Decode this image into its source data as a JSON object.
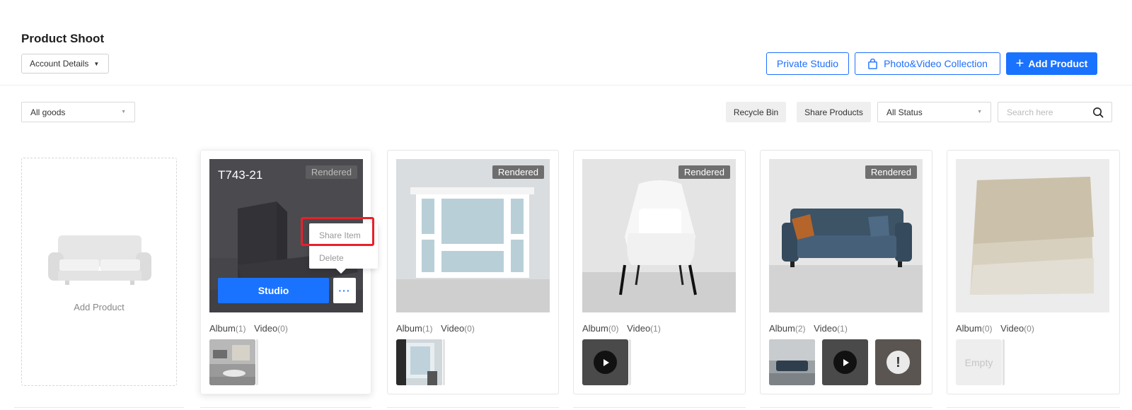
{
  "header": {
    "title": "Product Shoot",
    "account_label": "Account Details",
    "private_studio": "Private Studio",
    "collection": "Photo&Video Collection",
    "add_product": "Add Product"
  },
  "filters": {
    "goods": "All goods",
    "recycle_bin": "Recycle Bin",
    "share_products": "Share Products",
    "status": "All Status",
    "search_placeholder": "Search here"
  },
  "add_card": {
    "label": "Add Product"
  },
  "cards": [
    {
      "sku": "T743-21",
      "badge": "Rendered",
      "studio": "Studio",
      "more": "···",
      "album_label": "Album",
      "album_count": "(1)",
      "video_label": "Video",
      "video_count": "(0)"
    },
    {
      "badge": "Rendered",
      "album_label": "Album",
      "album_count": "(1)",
      "video_label": "Video",
      "video_count": "(0)"
    },
    {
      "badge": "Rendered",
      "album_label": "Album",
      "album_count": "(0)",
      "video_label": "Video",
      "video_count": "(1)"
    },
    {
      "badge": "Rendered",
      "album_label": "Album",
      "album_count": "(2)",
      "video_label": "Video",
      "video_count": "(1)"
    },
    {
      "album_label": "Album",
      "album_count": "(0)",
      "video_label": "Video",
      "video_count": "(0)",
      "empty": "Empty"
    }
  ],
  "menu": {
    "share": "Share Item",
    "delete": "Delete"
  },
  "colors": {
    "primary": "#1a73ff",
    "highlight": "#e8202a"
  }
}
